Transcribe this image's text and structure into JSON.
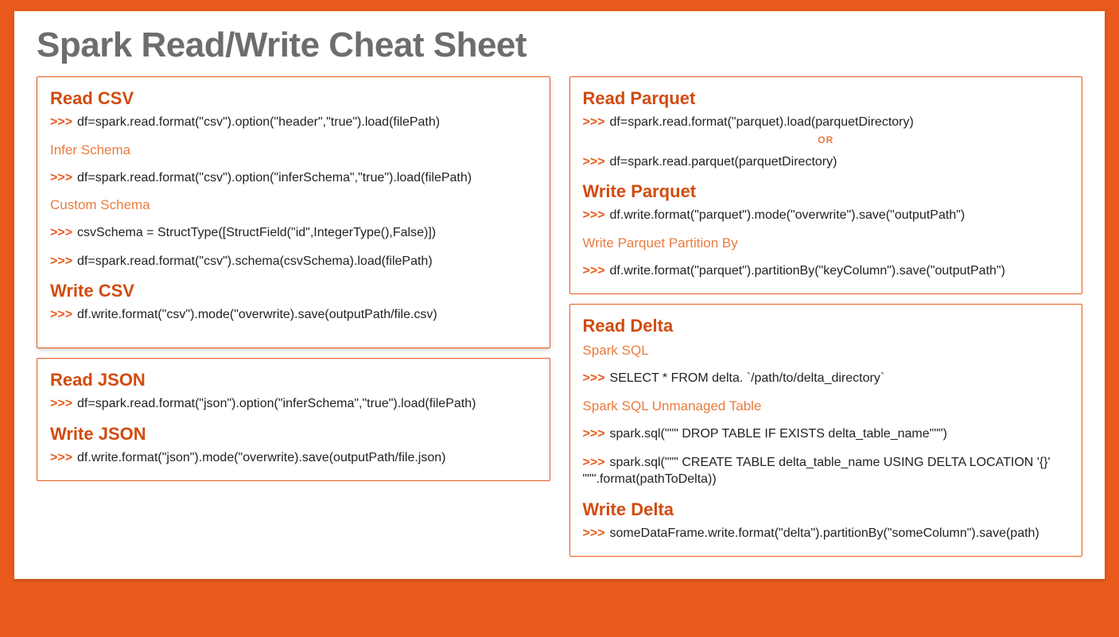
{
  "title": "Spark Read/Write Cheat Sheet",
  "prompt": ">>>",
  "or": "OR",
  "left": {
    "csv": {
      "read_title": "Read CSV",
      "read_line": "df=spark.read.format(\"csv\").option(\"header\",\"true\").load(filePath)",
      "infer_title": "Infer Schema",
      "infer_line": "df=spark.read.format(\"csv\").option(\"inferSchema\",\"true\").load(filePath)",
      "custom_title": "Custom Schema",
      "custom_line1": "csvSchema = StructType([StructField(\"id\",IntegerType(),False)])",
      "custom_line2": "df=spark.read.format(\"csv\").schema(csvSchema).load(filePath)",
      "write_title": "Write CSV",
      "write_line": "df.write.format(\"csv\").mode(\"overwrite).save(outputPath/file.csv)"
    },
    "json": {
      "read_title": "Read JSON",
      "read_line": "df=spark.read.format(\"json\").option(\"inferSchema\",\"true\").load(filePath)",
      "write_title": "Write JSON",
      "write_line": "df.write.format(\"json\").mode(\"overwrite).save(outputPath/file.json)"
    }
  },
  "right": {
    "parquet": {
      "read_title": "Read Parquet",
      "read_line1": "df=spark.read.format(\"parquet).load(parquetDirectory)",
      "read_line2": "df=spark.read.parquet(parquetDirectory)",
      "write_title": "Write Parquet",
      "write_line": "df.write.format(\"parquet\").mode(\"overwrite\").save(\"outputPath\")",
      "partition_title": "Write Parquet Partition By",
      "partition_line": "df.write.format(\"parquet\").partitionBy(\"keyColumn\").save(\"outputPath\")"
    },
    "delta": {
      "read_title": "Read Delta",
      "sql_title": "Spark SQL",
      "sql_line": "SELECT * FROM delta. `/path/to/delta_directory`",
      "unmanaged_title": "Spark SQL Unmanaged Table",
      "unmanaged_line1": "spark.sql(\"\"\" DROP TABLE IF EXISTS delta_table_name\"\"\")",
      "unmanaged_line2": "spark.sql(\"\"\" CREATE TABLE delta_table_name USING DELTA LOCATION '{}' \"\"\".format(pathToDelta))",
      "write_title": "Write Delta",
      "write_line": "someDataFrame.write.format(\"delta\").partitionBy(\"someColumn\").save(path)"
    }
  }
}
